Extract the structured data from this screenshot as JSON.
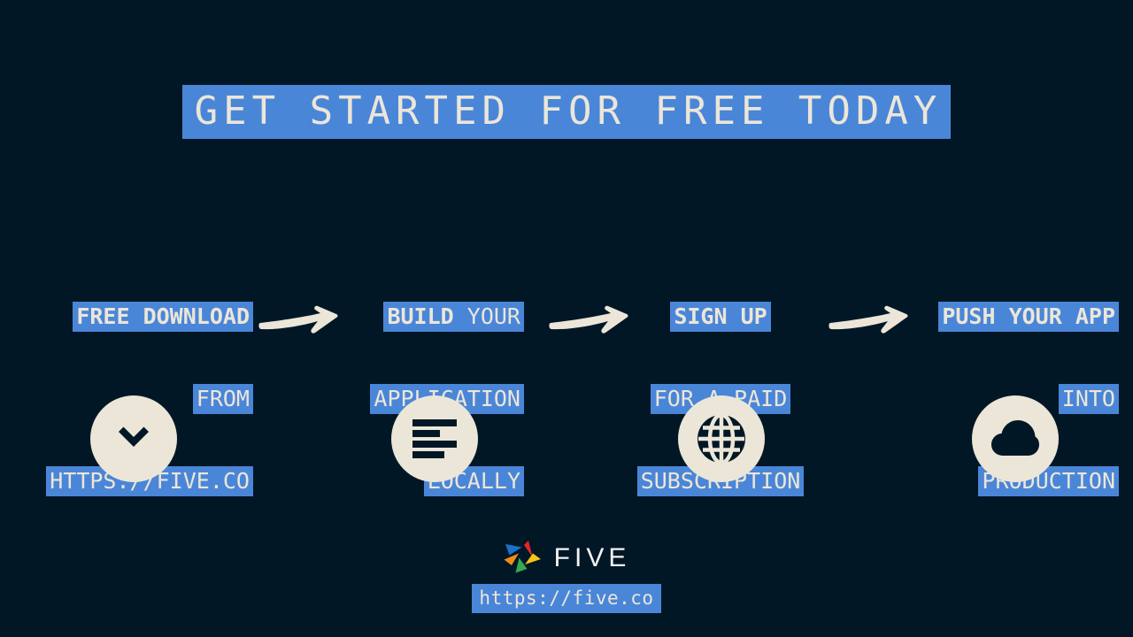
{
  "slide": {
    "background_color": "#021726",
    "accent_color": "#4a86d8",
    "text_color": "#ece6d8",
    "title": "GET STARTED FOR FREE TODAY"
  },
  "steps": [
    {
      "id": "step-1-download",
      "lines": [
        {
          "text": "FREE DOWNLOAD",
          "bold": true
        },
        {
          "text": "FROM",
          "bold": false
        },
        {
          "text": "HTTPS://FIVE.CO",
          "bold": false
        }
      ],
      "align": "right",
      "icon": "chevron-down-icon"
    },
    {
      "id": "step-2-build",
      "lines": [
        {
          "text": "BUILD",
          "bold": true
        },
        {
          "text": "YOUR",
          "bold": false
        },
        {
          "text": "APPLICATION",
          "bold": false
        },
        {
          "text": "LOCALLY",
          "bold": false
        }
      ],
      "align": "right",
      "icon": "document-lines-icon"
    },
    {
      "id": "step-3-signup",
      "lines": [
        {
          "text": "SIGN UP",
          "bold": true
        },
        {
          "text": "FOR A PAID",
          "bold": false
        },
        {
          "text": "SUBSCRIPTION",
          "bold": false
        }
      ],
      "align": "center",
      "icon": "globe-icon"
    },
    {
      "id": "step-4-push",
      "lines": [
        {
          "text": "PUSH YOUR APP",
          "bold": true
        },
        {
          "text": "INTO",
          "bold": false
        },
        {
          "text": "PRODUCTION",
          "bold": false
        }
      ],
      "align": "right",
      "icon": "cloud-icon"
    }
  ],
  "arrows": [
    {
      "name": "arrow-step1-to-step2",
      "icon": "arrow-right-icon"
    },
    {
      "name": "arrow-step2-to-step3",
      "icon": "arrow-right-icon"
    },
    {
      "name": "arrow-step3-to-step4",
      "icon": "arrow-right-icon"
    }
  ],
  "footer": {
    "logo_name": "five-logo",
    "logo_word": "FIVE",
    "logo_colors": {
      "blue": "#1a73c8",
      "red": "#e8232a",
      "yellow": "#f5c518",
      "green": "#34a853",
      "orange": "#f08c1a"
    },
    "url": "https://five.co"
  }
}
